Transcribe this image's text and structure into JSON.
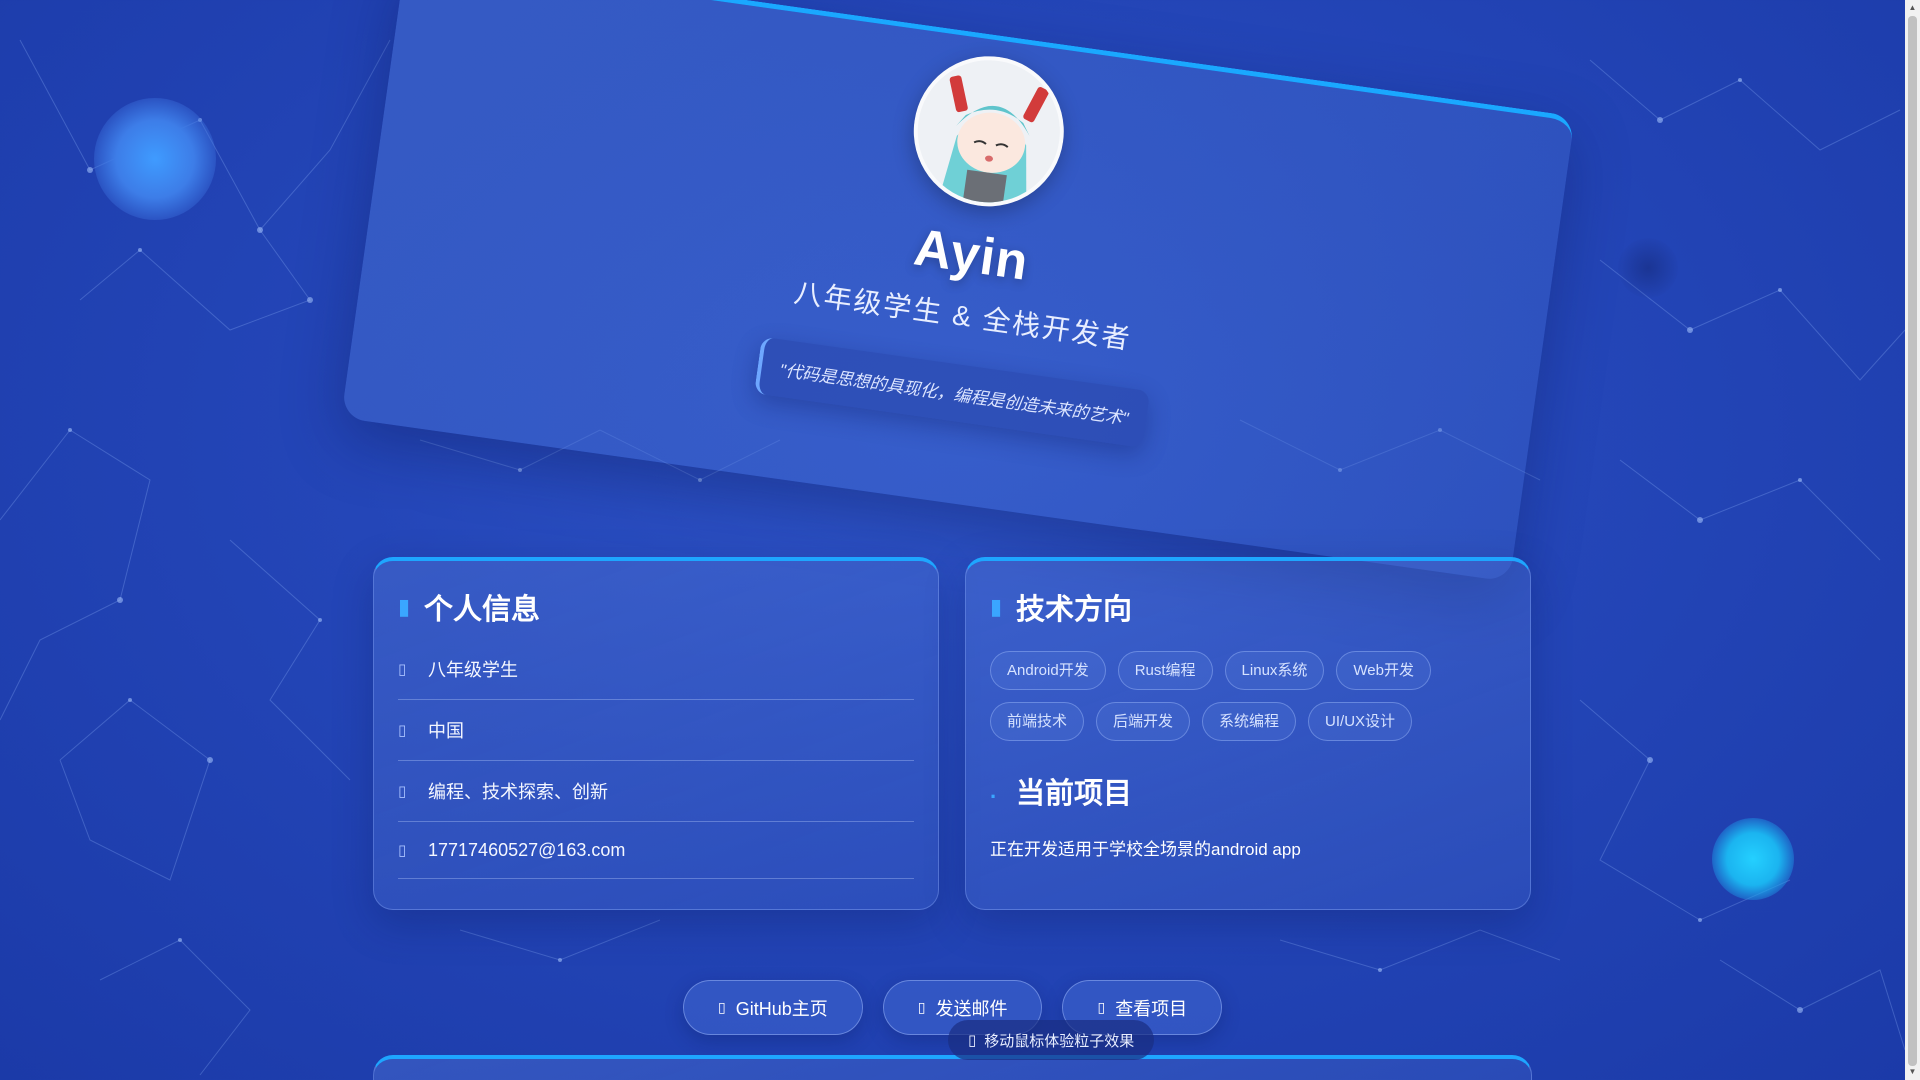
{
  "hero": {
    "name": "Ayin",
    "subtitle": "八年级学生 & 全栈开发者",
    "quote": "\"代码是思想的具现化，编程是创造未来的艺术\""
  },
  "personal": {
    "title": "个人信息",
    "items": [
      {
        "icon": "user-icon",
        "text": "八年级学生"
      },
      {
        "icon": "location-icon",
        "text": "中国"
      },
      {
        "icon": "heart-icon",
        "text": "编程、技术探索、创新"
      },
      {
        "icon": "mail-icon",
        "text": "17717460527@163.com"
      }
    ]
  },
  "tech": {
    "title": "技术方向",
    "tags": [
      "Android开发",
      "Rust编程",
      "Linux系统",
      "Web开发",
      "前端技术",
      "后端开发",
      "系统编程",
      "UI/UX设计"
    ]
  },
  "project": {
    "title": "当前项目",
    "text": "正在开发适用于学校全场景的android app"
  },
  "actions": [
    {
      "icon": "github-icon",
      "label": "GitHub主页"
    },
    {
      "icon": "envelope-icon",
      "label": "发送邮件"
    },
    {
      "icon": "code-icon",
      "label": "查看项目"
    }
  ],
  "hint": {
    "icon": "mouse-icon",
    "text": "移动鼠标体验粒子效果"
  },
  "colors": {
    "accent": "#1ea6ff",
    "background": "#2446b8"
  }
}
